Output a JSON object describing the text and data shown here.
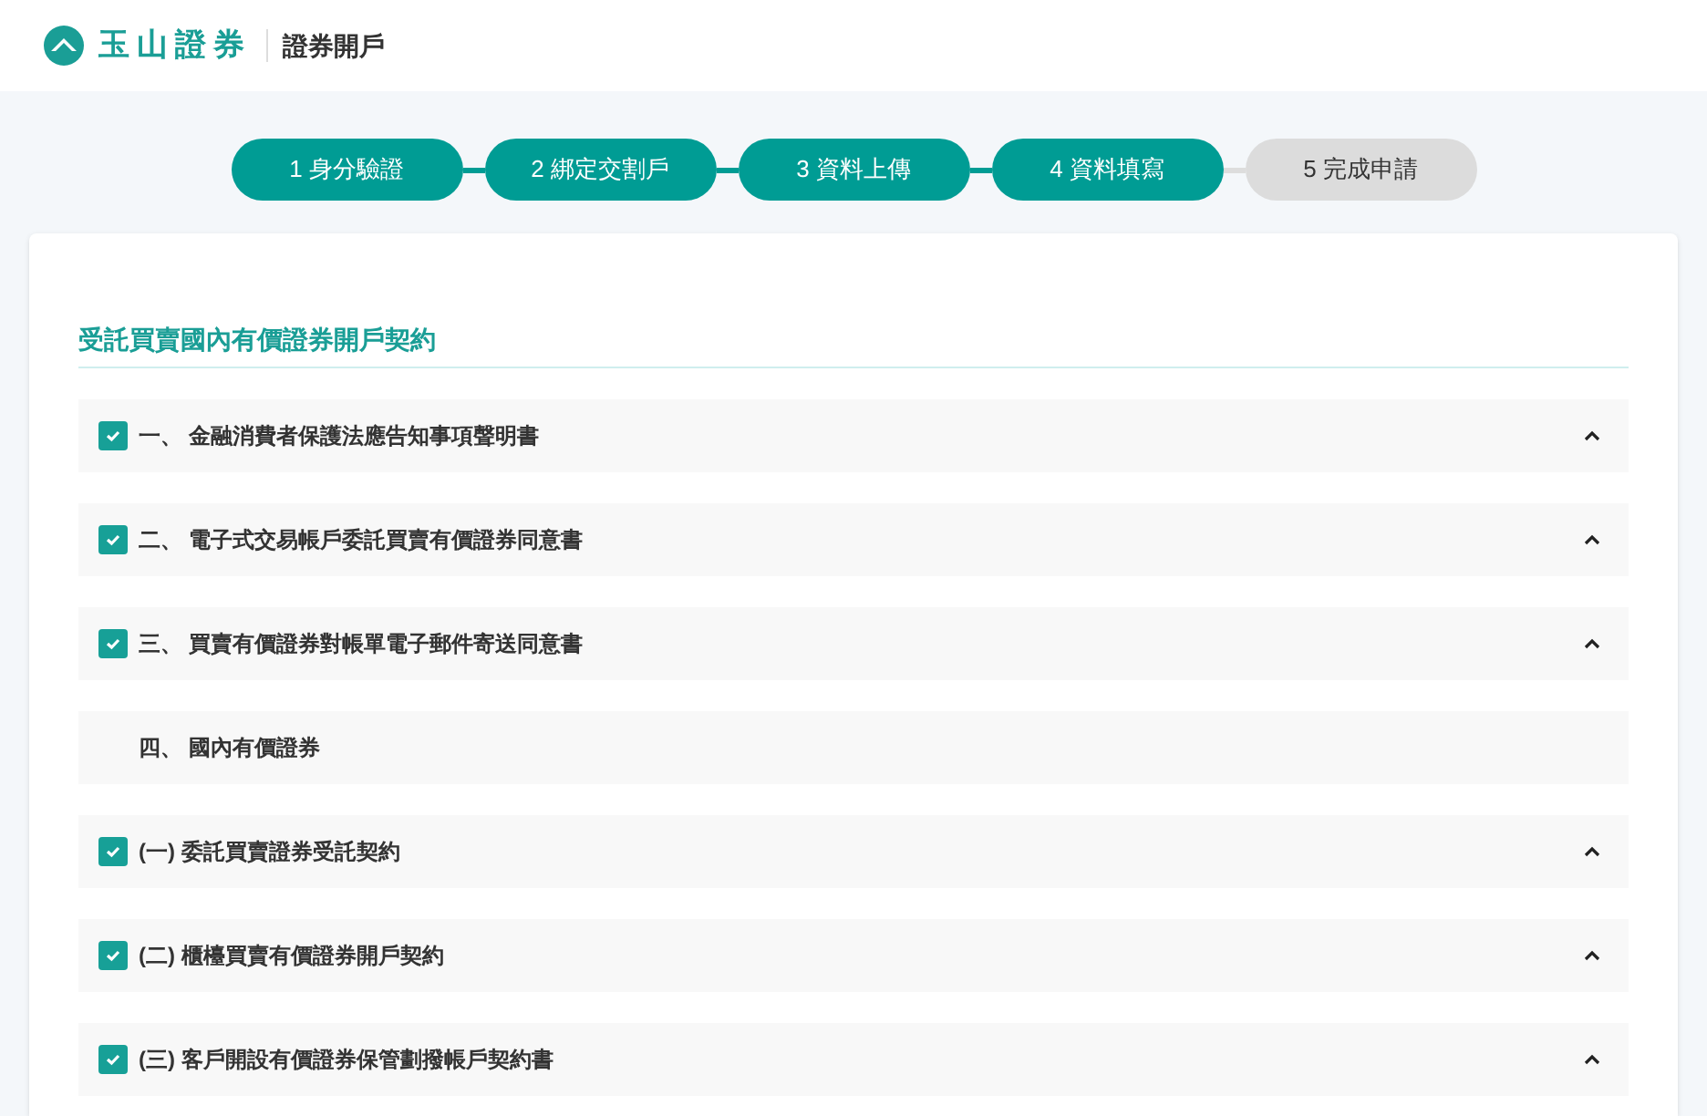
{
  "header": {
    "brand": "玉山證券",
    "title": "證券開戶"
  },
  "steps": [
    {
      "label": "1 身分驗證",
      "done": true
    },
    {
      "label": "2 綁定交割戶",
      "done": true
    },
    {
      "label": "3 資料上傳",
      "done": true
    },
    {
      "label": "4 資料填寫",
      "done": true
    },
    {
      "label": "5 完成申請",
      "done": false
    }
  ],
  "section_title": "受託買賣國內有價證券開戶契約",
  "items": [
    {
      "kind": "checkbox",
      "label": "一、 金融消費者保護法應告知事項聲明書",
      "checked": true
    },
    {
      "kind": "checkbox",
      "label": "二、 電子式交易帳戶委託買賣有價證券同意書",
      "checked": true
    },
    {
      "kind": "checkbox",
      "label": "三、 買賣有價證券對帳單電子郵件寄送同意書",
      "checked": true
    },
    {
      "kind": "heading",
      "label": "四、 國內有價證券"
    },
    {
      "kind": "checkbox",
      "label": "(一) 委託買賣證券受託契約",
      "checked": true
    },
    {
      "kind": "checkbox",
      "label": "(二) 櫃檯買賣有價證券開戶契約",
      "checked": true
    },
    {
      "kind": "checkbox",
      "label": "(三) 客戶開設有價證券保管劃撥帳戶契約書",
      "checked": true
    }
  ]
}
